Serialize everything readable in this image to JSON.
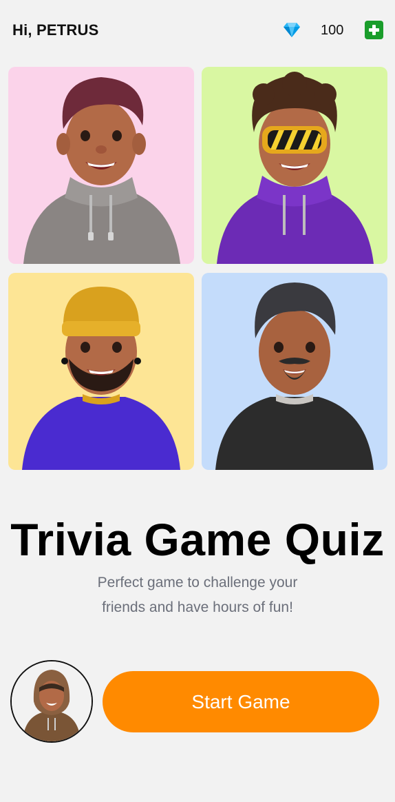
{
  "header": {
    "greeting": "Hi, PETRUS",
    "gem_count": "100"
  },
  "avatars": [
    {
      "name": "avatar-pink",
      "bg": "#fbd3ea",
      "hair": "#6e2a3a",
      "top": "#8a8583",
      "icon": "avatar-grey-hoodie-icon"
    },
    {
      "name": "avatar-green",
      "bg": "#d9f7a2",
      "hair": "#4a2b1a",
      "top": "#6c2bb5",
      "icon": "avatar-goggles-icon"
    },
    {
      "name": "avatar-yellow",
      "bg": "#fde595",
      "hair": "#d9a11e",
      "top": "#4a2bd0",
      "icon": "avatar-beanie-icon"
    },
    {
      "name": "avatar-blue",
      "bg": "#c4dcfb",
      "hair": "#3a3a3f",
      "top": "#2c2c2c",
      "icon": "avatar-dark-shirt-icon"
    }
  ],
  "main": {
    "title": "Trivia Game Quiz",
    "subtitle_line1": "Perfect game to challenge your",
    "subtitle_line2": "friends and have hours of fun!"
  },
  "actions": {
    "start_label": "Start Game"
  },
  "colors": {
    "accent": "#ff8a00",
    "add_button": "#1a9d2b",
    "background": "#f2f2f2"
  }
}
